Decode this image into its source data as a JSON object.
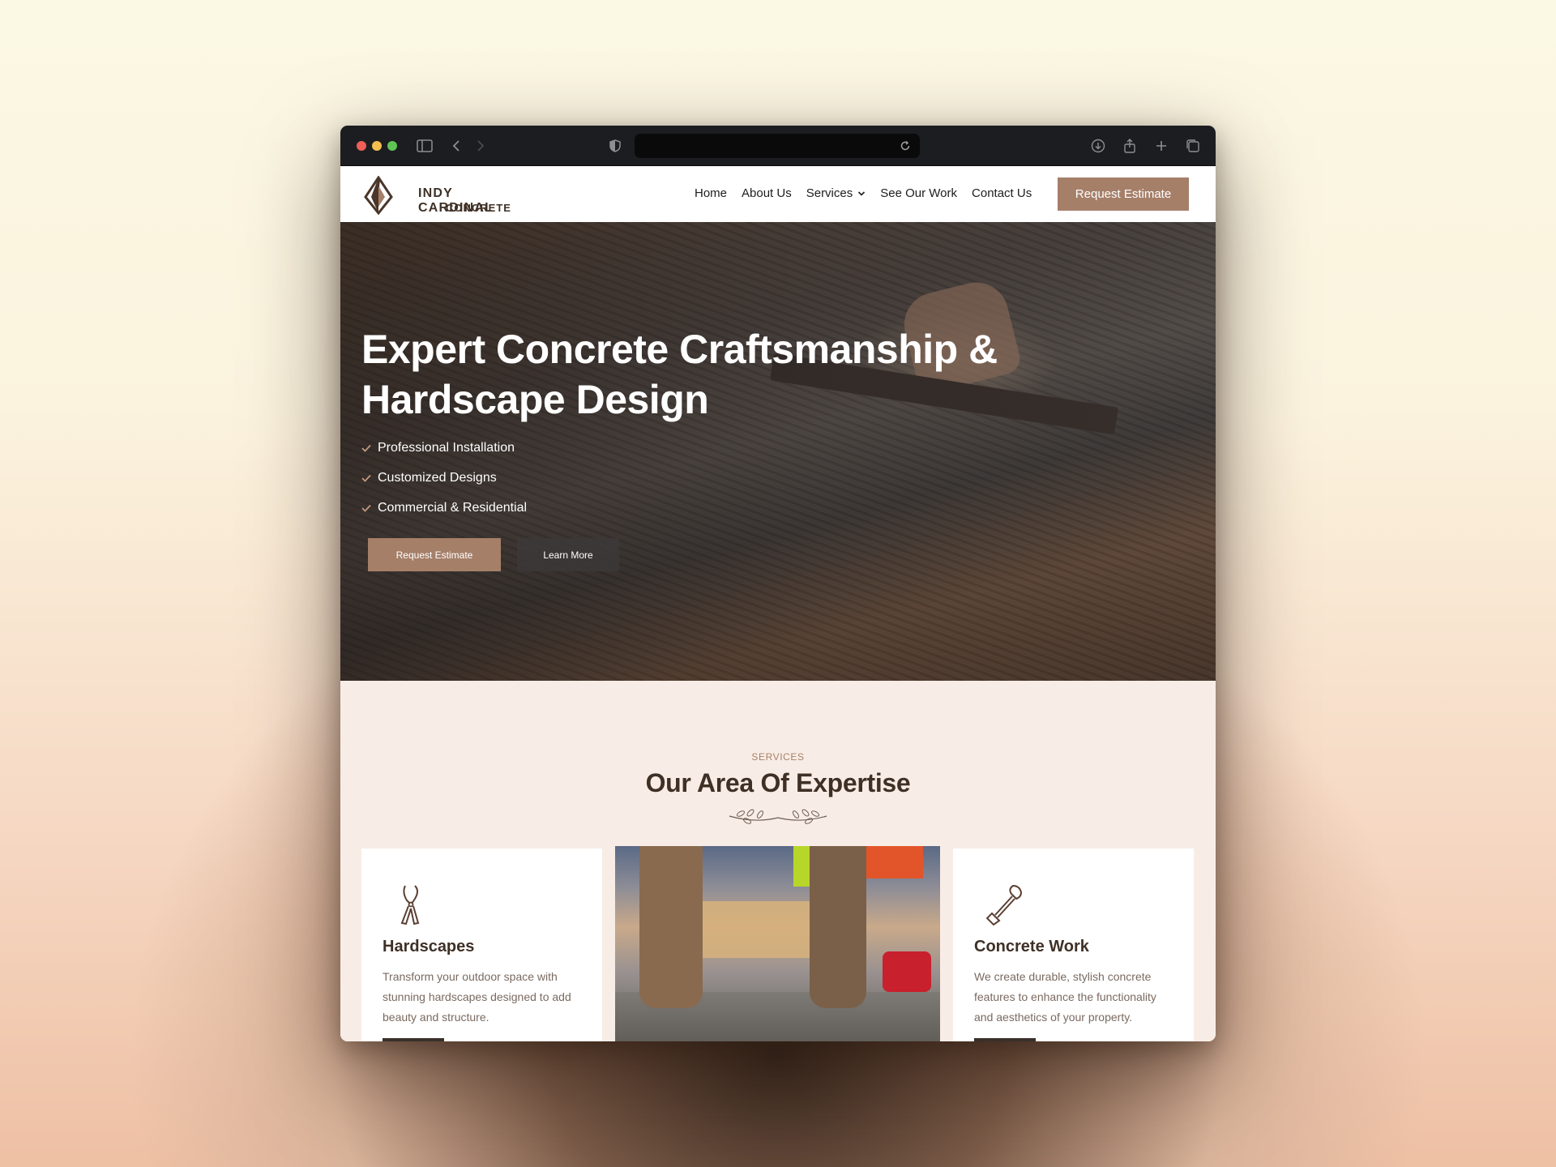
{
  "brand": {
    "name_line1": "INDY CARDINAL",
    "name_line2": "CONCRETE"
  },
  "nav": {
    "items": [
      {
        "label": "Home"
      },
      {
        "label": "About Us"
      },
      {
        "label": "Services"
      },
      {
        "label": "See Our Work"
      },
      {
        "label": "Contact Us"
      }
    ],
    "cta_label": "Request Estimate"
  },
  "hero": {
    "title": "Expert Concrete Craftsmanship & Hardscape Design",
    "checklist": [
      "Professional Installation",
      "Customized Designs",
      "Commercial & Residential"
    ],
    "primary_button": "Request Estimate",
    "secondary_button": "Learn More"
  },
  "services": {
    "eyebrow": "SERVICES",
    "title": "Our Area Of Expertise",
    "cards": [
      {
        "icon": "pruning-shears-icon",
        "title": "Hardscapes",
        "text": "Transform your outdoor space with stunning hardscapes designed to add beauty and structure."
      },
      {
        "icon": "shovel-icon",
        "title": "Concrete Work",
        "text": "We create durable, stylish concrete features to enhance the functionality and aesthetics of your property."
      }
    ]
  },
  "colors": {
    "accent": "#a67f69",
    "heading": "#3f3026",
    "section_bg": "#f8ede6",
    "chrome_bg": "#1c1d20"
  }
}
